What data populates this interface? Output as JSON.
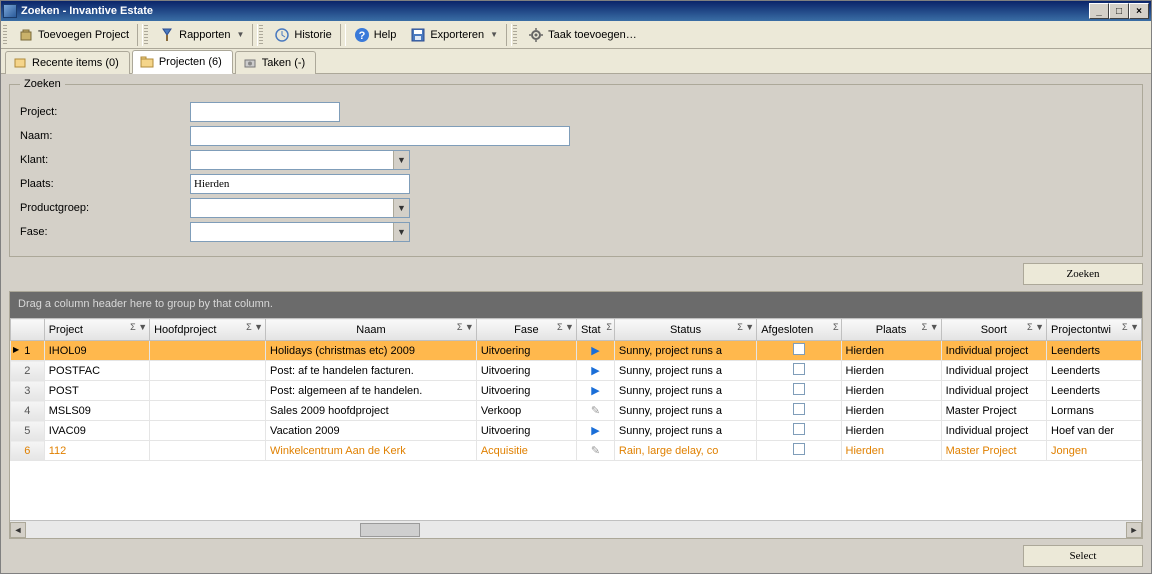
{
  "window": {
    "title": "Zoeken - Invantive Estate"
  },
  "titlebar_buttons": {
    "min": "_",
    "max": "□",
    "close": "×"
  },
  "toolbar": {
    "add_project": "Toevoegen Project",
    "reports": "Rapporten",
    "history": "Historie",
    "help": "Help",
    "export": "Exporteren",
    "add_task": "Taak toevoegen…"
  },
  "tabs": {
    "recent": "Recente items (0)",
    "projects": "Projecten (6)",
    "tasks": "Taken (-)"
  },
  "search": {
    "legend": "Zoeken",
    "labels": {
      "project": "Project:",
      "naam": "Naam:",
      "klant": "Klant:",
      "plaats": "Plaats:",
      "productgroep": "Productgroep:",
      "fase": "Fase:"
    },
    "values": {
      "project": "",
      "naam": "",
      "klant": "",
      "plaats": "Hierden",
      "productgroep": "",
      "fase": ""
    },
    "button": "Zoeken"
  },
  "grid": {
    "group_text": "Drag a column header here to group by that column.",
    "columns": [
      "",
      "Project",
      "Hoofdproject",
      "Naam",
      "Fase",
      "Stat",
      "Status",
      "Afgesloten",
      "Plaats",
      "Soort",
      "Projectontwi"
    ],
    "rows": [
      {
        "n": "1",
        "project": "IHOL09",
        "hoofd": "",
        "naam": "Holidays (christmas etc) 2009",
        "fase": "Uitvoering",
        "stat": "play",
        "status": "Sunny, project runs a",
        "afg": false,
        "plaats": "Hierden",
        "soort": "Individual project",
        "ontw": "Leenderts",
        "sel": true
      },
      {
        "n": "2",
        "project": "POSTFAC",
        "hoofd": "",
        "naam": "Post: af te handelen facturen.",
        "fase": "Uitvoering",
        "stat": "play",
        "status": "Sunny, project runs a",
        "afg": false,
        "plaats": "Hierden",
        "soort": "Individual project",
        "ontw": "Leenderts"
      },
      {
        "n": "3",
        "project": "POST",
        "hoofd": "",
        "naam": "Post: algemeen af te handelen.",
        "fase": "Uitvoering",
        "stat": "play",
        "status": "Sunny, project runs a",
        "afg": false,
        "plaats": "Hierden",
        "soort": "Individual project",
        "ontw": "Leenderts"
      },
      {
        "n": "4",
        "project": "MSLS09",
        "hoofd": "",
        "naam": "Sales 2009 hoofdproject",
        "fase": "Verkoop",
        "stat": "edit",
        "status": "Sunny, project runs a",
        "afg": false,
        "plaats": "Hierden",
        "soort": "Master Project",
        "ontw": "Lormans"
      },
      {
        "n": "5",
        "project": "IVAC09",
        "hoofd": "",
        "naam": "Vacation 2009",
        "fase": "Uitvoering",
        "stat": "play",
        "status": "Sunny, project runs a",
        "afg": false,
        "plaats": "Hierden",
        "soort": "Individual project",
        "ontw": "Hoef van der"
      },
      {
        "n": "6",
        "project": "112",
        "hoofd": "",
        "naam": "Winkelcentrum Aan de Kerk",
        "fase": "Acquisitie",
        "stat": "edit",
        "status": "Rain, large delay, co",
        "afg": false,
        "plaats": "Hierden",
        "soort": "Master Project",
        "ontw": "Jongen",
        "orange": true
      }
    ],
    "select_button": "Select"
  }
}
